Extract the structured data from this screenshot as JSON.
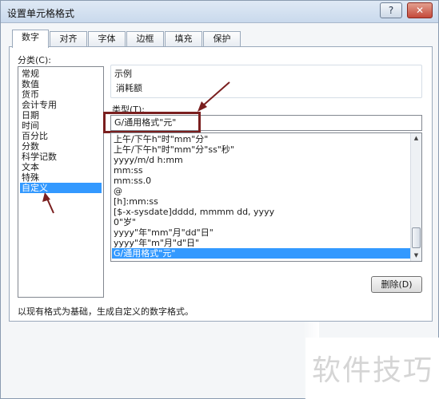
{
  "window": {
    "title": "设置单元格格式",
    "help_glyph": "?",
    "close_glyph": "✕"
  },
  "tabs": [
    {
      "label": "数字",
      "active": true
    },
    {
      "label": "对齐",
      "active": false
    },
    {
      "label": "字体",
      "active": false
    },
    {
      "label": "边框",
      "active": false
    },
    {
      "label": "填充",
      "active": false
    },
    {
      "label": "保护",
      "active": false
    }
  ],
  "category": {
    "label": "分类(C):",
    "items": [
      "常规",
      "数值",
      "货币",
      "会计专用",
      "日期",
      "时间",
      "百分比",
      "分数",
      "科学记数",
      "文本",
      "特殊",
      "自定义"
    ],
    "selected": "自定义"
  },
  "sample": {
    "caption": "示例",
    "value": "消耗额"
  },
  "type": {
    "label": "类型(T):",
    "value": "G/通用格式\"元\""
  },
  "format_list": {
    "items": [
      "上午/下午h\"时\"mm\"分\"",
      "上午/下午h\"时\"mm\"分\"ss\"秒\"",
      "yyyy/m/d h:mm",
      "mm:ss",
      "mm:ss.0",
      "@",
      "[h]:mm:ss",
      "[$-x-sysdate]dddd, mmmm dd, yyyy",
      "0\"岁\"",
      "yyyy\"年\"mm\"月\"dd\"日\"",
      "yyyy\"年\"m\"月\"d\"日\"",
      "G/通用格式\"元\""
    ],
    "selected_index": 11
  },
  "buttons": {
    "delete_label": "删除(D)"
  },
  "description": "以现有格式为基础，生成自定义的数字格式。",
  "watermark": "软件技巧",
  "colors": {
    "selection": "#3399ff",
    "annotation": "#7a1f1f"
  }
}
